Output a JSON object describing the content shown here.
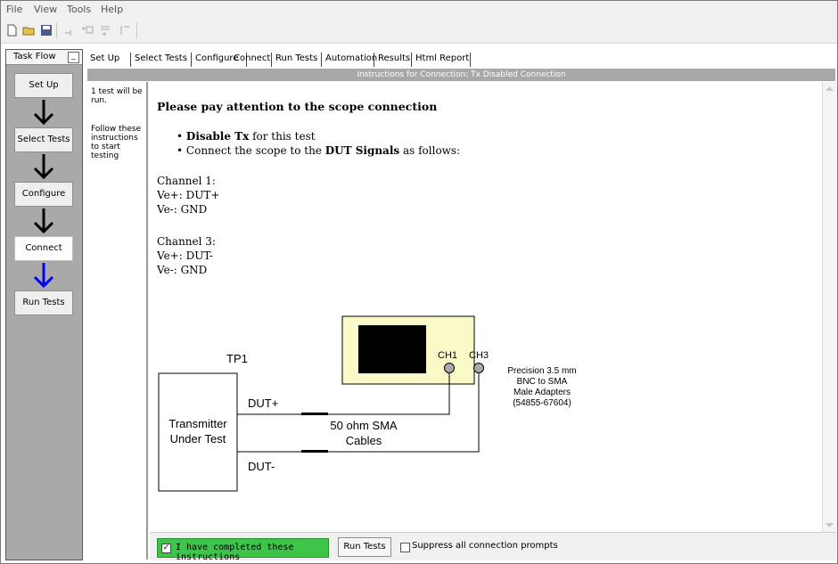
{
  "menu": {
    "file": "File",
    "view": "View",
    "tools": "Tools",
    "help": "Help"
  },
  "toolbar": {
    "icons": [
      "new-document-icon",
      "open-folder-icon",
      "save-icon",
      "connect-icon",
      "checkbox-list-icon",
      "list-run-icon",
      "step-icon"
    ]
  },
  "taskflow": {
    "title": "Task Flow",
    "minimize": "_",
    "steps": [
      {
        "label": "Set Up"
      },
      {
        "label": "Select Tests"
      },
      {
        "label": "Configure"
      },
      {
        "label": "Connect"
      },
      {
        "label": "Run Tests"
      }
    ],
    "arrow_colors": [
      "#000000",
      "#000000",
      "#000000",
      "#0000ff"
    ]
  },
  "tabs": [
    "Set Up",
    "Select Tests",
    "Configure",
    "Connect",
    "Run Tests",
    "Automation",
    "Results",
    "Html Report"
  ],
  "active_tab": "Connect",
  "instructions_header": "Instructions for Connection: Tx Disabled Connection",
  "notes": {
    "test_count": "1 test will be run.",
    "follow": "Follow these instructions to start testing"
  },
  "content": {
    "heading": "Please pay attention to the scope connection",
    "bullet1_bold": "Disable Tx",
    "bullet1_rest": " for this test",
    "bullet2_pre": "Connect the scope to the ",
    "bullet2_bold": "DUT Signals",
    "bullet2_post": " as follows:",
    "ch1_title": "Channel 1:",
    "ch1_pos": "Ve+: DUT+",
    "ch1_neg": "Ve-: GND",
    "ch3_title": "Channel 3:",
    "ch3_pos": "Ve+: DUT-",
    "ch3_neg": "Ve-: GND"
  },
  "diagram": {
    "tp1": "TP1",
    "ch1": "CH1",
    "ch3": "CH3",
    "dut_plus": "DUT+",
    "dut_minus": "DUT-",
    "transmitter_line1": "Transmitter",
    "transmitter_line2": "Under Test",
    "cable_line1": "50 ohm SMA",
    "cable_line2": "Cables",
    "adapter_line1": "Precision 3.5 mm",
    "adapter_line2": "BNC to SMA",
    "adapter_line3": "Male Adapters",
    "adapter_line4": "(54855-67604)",
    "scope_color": "#fafac8"
  },
  "bottom": {
    "completed_label": "I have completed these instructions",
    "completed_checked": true,
    "run_tests": "Run Tests",
    "suppress_label": "Suppress all connection prompts",
    "suppress_checked": false
  },
  "colors": {
    "completed_bg": "#3cc548",
    "flow_panel": "#a9a9a9"
  }
}
